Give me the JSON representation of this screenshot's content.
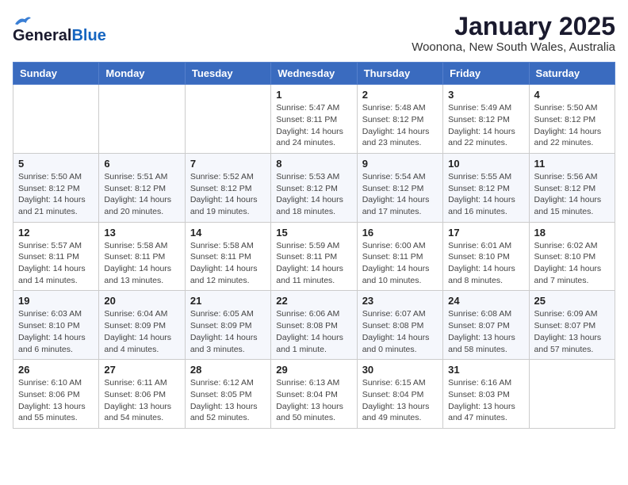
{
  "header": {
    "logo_general": "General",
    "logo_blue": "Blue",
    "title": "January 2025",
    "subtitle": "Woonona, New South Wales, Australia"
  },
  "calendar": {
    "days_of_week": [
      "Sunday",
      "Monday",
      "Tuesday",
      "Wednesday",
      "Thursday",
      "Friday",
      "Saturday"
    ],
    "weeks": [
      [
        {
          "day": "",
          "info": ""
        },
        {
          "day": "",
          "info": ""
        },
        {
          "day": "",
          "info": ""
        },
        {
          "day": "1",
          "info": "Sunrise: 5:47 AM\nSunset: 8:11 PM\nDaylight: 14 hours\nand 24 minutes."
        },
        {
          "day": "2",
          "info": "Sunrise: 5:48 AM\nSunset: 8:12 PM\nDaylight: 14 hours\nand 23 minutes."
        },
        {
          "day": "3",
          "info": "Sunrise: 5:49 AM\nSunset: 8:12 PM\nDaylight: 14 hours\nand 22 minutes."
        },
        {
          "day": "4",
          "info": "Sunrise: 5:50 AM\nSunset: 8:12 PM\nDaylight: 14 hours\nand 22 minutes."
        }
      ],
      [
        {
          "day": "5",
          "info": "Sunrise: 5:50 AM\nSunset: 8:12 PM\nDaylight: 14 hours\nand 21 minutes."
        },
        {
          "day": "6",
          "info": "Sunrise: 5:51 AM\nSunset: 8:12 PM\nDaylight: 14 hours\nand 20 minutes."
        },
        {
          "day": "7",
          "info": "Sunrise: 5:52 AM\nSunset: 8:12 PM\nDaylight: 14 hours\nand 19 minutes."
        },
        {
          "day": "8",
          "info": "Sunrise: 5:53 AM\nSunset: 8:12 PM\nDaylight: 14 hours\nand 18 minutes."
        },
        {
          "day": "9",
          "info": "Sunrise: 5:54 AM\nSunset: 8:12 PM\nDaylight: 14 hours\nand 17 minutes."
        },
        {
          "day": "10",
          "info": "Sunrise: 5:55 AM\nSunset: 8:12 PM\nDaylight: 14 hours\nand 16 minutes."
        },
        {
          "day": "11",
          "info": "Sunrise: 5:56 AM\nSunset: 8:12 PM\nDaylight: 14 hours\nand 15 minutes."
        }
      ],
      [
        {
          "day": "12",
          "info": "Sunrise: 5:57 AM\nSunset: 8:11 PM\nDaylight: 14 hours\nand 14 minutes."
        },
        {
          "day": "13",
          "info": "Sunrise: 5:58 AM\nSunset: 8:11 PM\nDaylight: 14 hours\nand 13 minutes."
        },
        {
          "day": "14",
          "info": "Sunrise: 5:58 AM\nSunset: 8:11 PM\nDaylight: 14 hours\nand 12 minutes."
        },
        {
          "day": "15",
          "info": "Sunrise: 5:59 AM\nSunset: 8:11 PM\nDaylight: 14 hours\nand 11 minutes."
        },
        {
          "day": "16",
          "info": "Sunrise: 6:00 AM\nSunset: 8:11 PM\nDaylight: 14 hours\nand 10 minutes."
        },
        {
          "day": "17",
          "info": "Sunrise: 6:01 AM\nSunset: 8:10 PM\nDaylight: 14 hours\nand 8 minutes."
        },
        {
          "day": "18",
          "info": "Sunrise: 6:02 AM\nSunset: 8:10 PM\nDaylight: 14 hours\nand 7 minutes."
        }
      ],
      [
        {
          "day": "19",
          "info": "Sunrise: 6:03 AM\nSunset: 8:10 PM\nDaylight: 14 hours\nand 6 minutes."
        },
        {
          "day": "20",
          "info": "Sunrise: 6:04 AM\nSunset: 8:09 PM\nDaylight: 14 hours\nand 4 minutes."
        },
        {
          "day": "21",
          "info": "Sunrise: 6:05 AM\nSunset: 8:09 PM\nDaylight: 14 hours\nand 3 minutes."
        },
        {
          "day": "22",
          "info": "Sunrise: 6:06 AM\nSunset: 8:08 PM\nDaylight: 14 hours\nand 1 minute."
        },
        {
          "day": "23",
          "info": "Sunrise: 6:07 AM\nSunset: 8:08 PM\nDaylight: 14 hours\nand 0 minutes."
        },
        {
          "day": "24",
          "info": "Sunrise: 6:08 AM\nSunset: 8:07 PM\nDaylight: 13 hours\nand 58 minutes."
        },
        {
          "day": "25",
          "info": "Sunrise: 6:09 AM\nSunset: 8:07 PM\nDaylight: 13 hours\nand 57 minutes."
        }
      ],
      [
        {
          "day": "26",
          "info": "Sunrise: 6:10 AM\nSunset: 8:06 PM\nDaylight: 13 hours\nand 55 minutes."
        },
        {
          "day": "27",
          "info": "Sunrise: 6:11 AM\nSunset: 8:06 PM\nDaylight: 13 hours\nand 54 minutes."
        },
        {
          "day": "28",
          "info": "Sunrise: 6:12 AM\nSunset: 8:05 PM\nDaylight: 13 hours\nand 52 minutes."
        },
        {
          "day": "29",
          "info": "Sunrise: 6:13 AM\nSunset: 8:04 PM\nDaylight: 13 hours\nand 50 minutes."
        },
        {
          "day": "30",
          "info": "Sunrise: 6:15 AM\nSunset: 8:04 PM\nDaylight: 13 hours\nand 49 minutes."
        },
        {
          "day": "31",
          "info": "Sunrise: 6:16 AM\nSunset: 8:03 PM\nDaylight: 13 hours\nand 47 minutes."
        },
        {
          "day": "",
          "info": ""
        }
      ]
    ]
  }
}
